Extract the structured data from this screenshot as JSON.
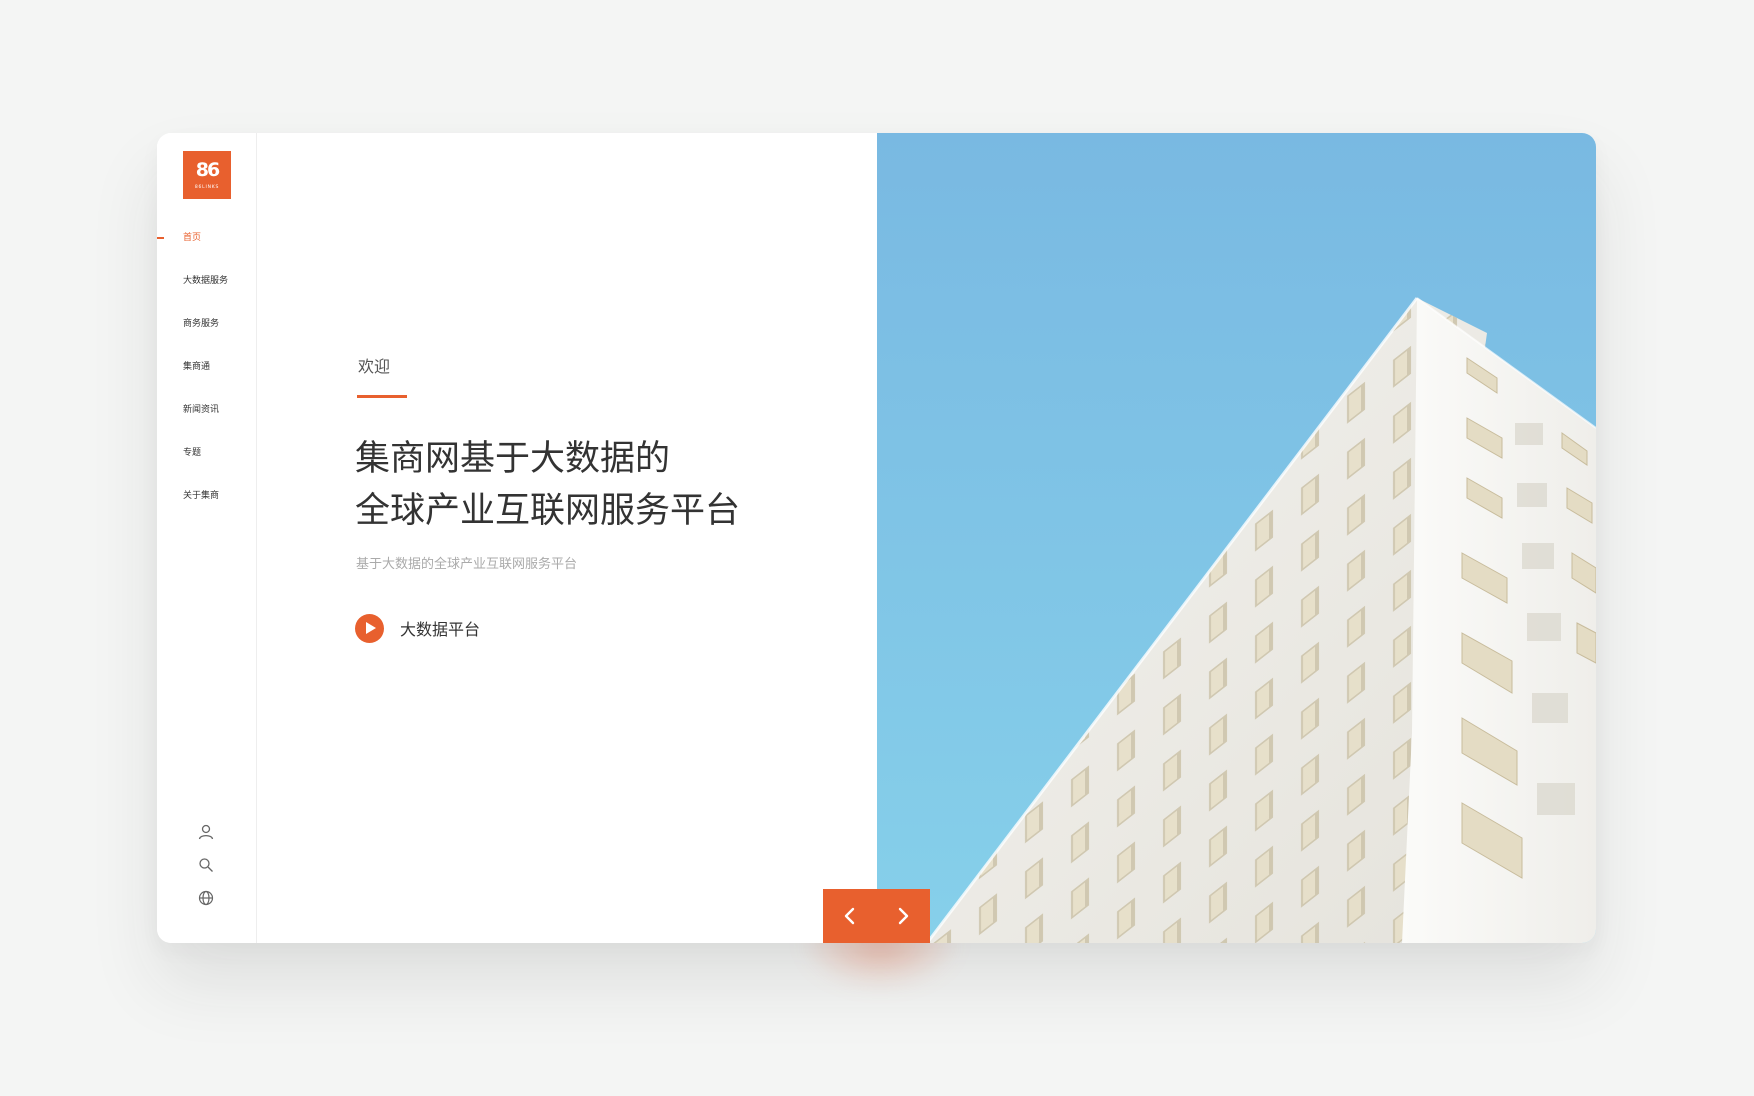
{
  "brand": {
    "logo_mark": "86",
    "logo_word": "86LINKS",
    "accent_color": "#e8602e"
  },
  "sidebar": {
    "items": [
      {
        "label": "首页",
        "active": true
      },
      {
        "label": "大数据服务",
        "active": false
      },
      {
        "label": "商务服务",
        "active": false
      },
      {
        "label": "集商通",
        "active": false
      },
      {
        "label": "新闻资讯",
        "active": false
      },
      {
        "label": "专题",
        "active": false
      },
      {
        "label": "关于集商",
        "active": false
      }
    ],
    "utility_icons": [
      "user-icon",
      "search-icon",
      "globe-icon"
    ]
  },
  "hero": {
    "eyebrow": "欢迎",
    "headline_line1": "集商网基于大数据的",
    "headline_line2": "全球产业互联网服务平台",
    "subtitle": "基于大数据的全球产业互联网服务平台",
    "cta_label": "大数据平台",
    "image": "white-building-blue-sky"
  },
  "carousel": {
    "prev_icon": "chevron-left-icon",
    "next_icon": "chevron-right-icon"
  }
}
